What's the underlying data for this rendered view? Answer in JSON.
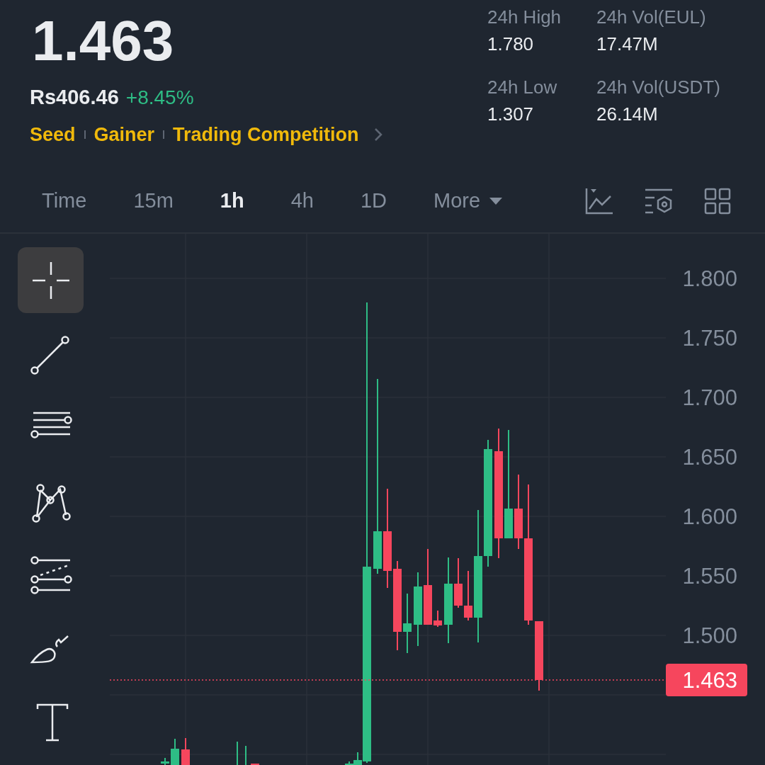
{
  "ticker": {
    "price": "1.463",
    "fiat_price": "Rs406.46",
    "change": "+8.45%"
  },
  "tags": [
    "Seed",
    "Gainer",
    "Trading Competition"
  ],
  "stats": [
    {
      "label": "24h High",
      "value": "1.780"
    },
    {
      "label": "24h Vol(EUL)",
      "value": "17.47M"
    },
    {
      "label": "24h Low",
      "value": "1.307"
    },
    {
      "label": "24h Vol(USDT)",
      "value": "26.14M"
    }
  ],
  "intervals": [
    {
      "label": "Time",
      "kind": "option",
      "selected": false
    },
    {
      "label": "15m",
      "kind": "option",
      "selected": false
    },
    {
      "label": "1h",
      "kind": "option",
      "selected": true
    },
    {
      "label": "4h",
      "kind": "option",
      "selected": false
    },
    {
      "label": "1D",
      "kind": "option",
      "selected": false
    },
    {
      "label": "More",
      "kind": "dropdown",
      "selected": false
    }
  ],
  "drawing_tools": [
    {
      "kind": "crosshair",
      "selected": true
    },
    {
      "kind": "line",
      "selected": false
    },
    {
      "kind": "parallel",
      "selected": false
    },
    {
      "kind": "pattern",
      "selected": false
    },
    {
      "kind": "fib",
      "selected": false
    },
    {
      "kind": "brush",
      "selected": false
    },
    {
      "kind": "text",
      "selected": false
    }
  ],
  "chart": {
    "y_axis_labels": [
      "1.800",
      "1.750",
      "1.700",
      "1.650",
      "1.600",
      "1.550",
      "1.500"
    ],
    "last_price": "1.463"
  }
}
